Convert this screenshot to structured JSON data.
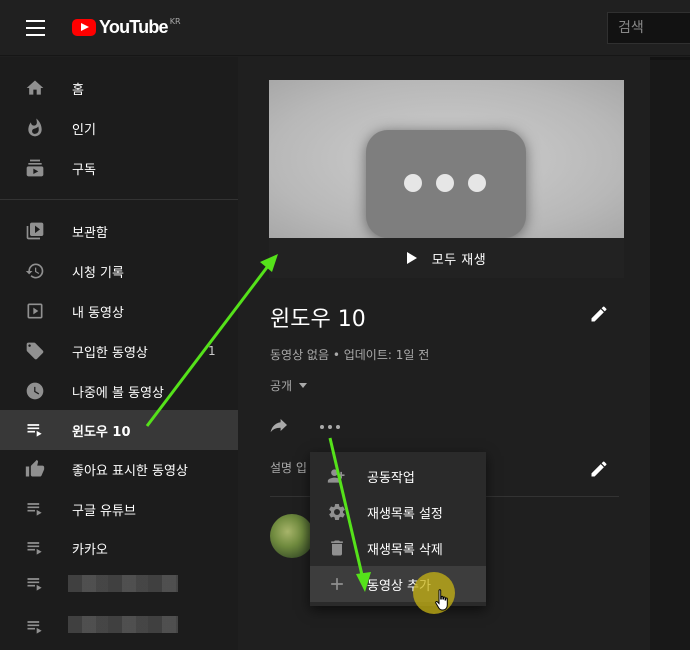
{
  "topbar": {
    "logo_text": "YouTube",
    "logo_region": "KR",
    "search_placeholder": "검색"
  },
  "sidebar": {
    "main_items": [
      {
        "label": "홈",
        "icon": "home-icon"
      },
      {
        "label": "인기",
        "icon": "fire-icon"
      },
      {
        "label": "구독",
        "icon": "subscriptions-icon"
      }
    ],
    "library_items": [
      {
        "label": "보관함",
        "icon": "library-icon"
      },
      {
        "label": "시청 기록",
        "icon": "history-icon"
      },
      {
        "label": "내 동영상",
        "icon": "my-videos-icon"
      },
      {
        "label": "구입한 동영상",
        "icon": "tag-icon",
        "count": "1"
      },
      {
        "label": "나중에 볼 동영상",
        "icon": "clock-icon"
      },
      {
        "label": "윈도우 10",
        "icon": "playlist-icon",
        "active": true
      },
      {
        "label": "좋아요 표시한 동영상",
        "icon": "thumbs-up-icon"
      },
      {
        "label": "구글 유튜브",
        "icon": "playlist-icon"
      },
      {
        "label": "카카오",
        "icon": "playlist-icon"
      }
    ]
  },
  "playlist": {
    "play_all": "모두 재생",
    "title": "윈도우 10",
    "meta": "동영상 없음 • 업데이트: 1일 전",
    "privacy": "공개",
    "description_label": "설명 입"
  },
  "context_menu": {
    "items": [
      {
        "label": "공동작업",
        "icon": "collaborate-icon"
      },
      {
        "label": "재생목록 설정",
        "icon": "gear-icon"
      },
      {
        "label": "재생목록 삭제",
        "icon": "trash-icon"
      },
      {
        "label": "동영상 추가",
        "icon": "plus-icon",
        "hover": true
      }
    ]
  },
  "colors": {
    "brand_red": "#ff0000",
    "annotation_arrow": "#55e21a",
    "cursor_highlight": "#c8b414",
    "background": "#1f1f1f",
    "sidebar_active": "#383838"
  }
}
